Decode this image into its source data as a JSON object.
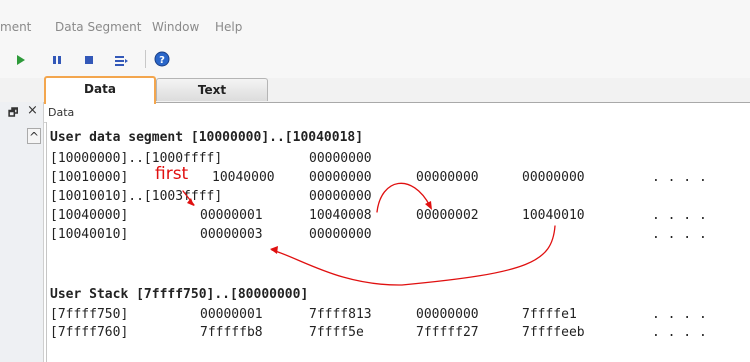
{
  "menu": [
    "ment",
    "Data Segment",
    "Window",
    "Help"
  ],
  "tabs": {
    "data": "Data",
    "text": "Text"
  },
  "panel": {
    "title": "Data",
    "close_glyph": "×",
    "restore_glyph": "🗗",
    "scroll_glyph": "^"
  },
  "data_segment": {
    "header": "User data segment [10000000]..[10040018]",
    "rows": [
      {
        "addr": "[10000000]..[1000ffff]",
        "v": [
          "00000000"
        ]
      },
      {
        "addr": "[10010000]",
        "v": [
          "10040000",
          "00000000",
          "00000000",
          "00000000"
        ],
        "dots": ". . . ."
      },
      {
        "addr": "[10010010]..[1003ffff]",
        "v": [
          "00000000"
        ]
      },
      {
        "addr": "[10040000]",
        "v": [
          "00000001",
          "10040008",
          "00000002",
          "10040010"
        ],
        "dots": ". . . ."
      },
      {
        "addr": "[10040010]",
        "v": [
          "00000003",
          "00000000"
        ],
        "dots": ". . . ."
      }
    ]
  },
  "stack": {
    "header": "User Stack [7ffff750]..[80000000]",
    "rows": [
      {
        "addr": "[7ffff750]",
        "v": [
          "00000001",
          "7ffff813",
          "00000000",
          "7ffffe1"
        ],
        "dots": ". . . ."
      },
      {
        "addr": "[7ffff760]",
        "v": [
          "7fffffb8",
          "7ffff5e",
          "7fffff27",
          "7ffffeeb"
        ],
        "dots": ". . . ."
      }
    ]
  },
  "annotation": {
    "text": "first",
    "color": "#e01010"
  }
}
